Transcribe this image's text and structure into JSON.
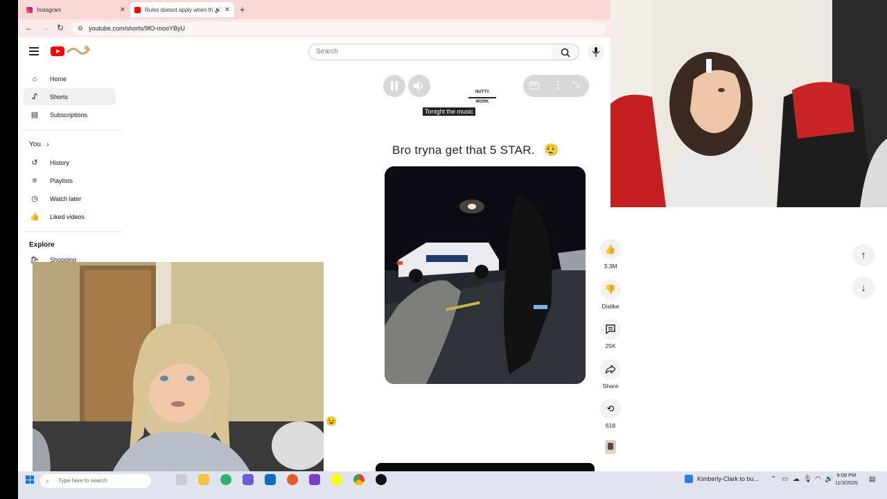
{
  "browser": {
    "tabs": [
      {
        "title": "Instagram",
        "favicon": "instagram-icon"
      },
      {
        "title": "Rules doesnt apply when th",
        "favicon": "youtube-icon",
        "active": true
      }
    ],
    "url": "youtube.com/shorts/9fO-mooYByU"
  },
  "header": {
    "search_placeholder": "Search"
  },
  "sidebar": {
    "items": [
      {
        "label": "Home",
        "icon": "home-icon"
      },
      {
        "label": "Shorts",
        "icon": "shorts-icon",
        "active": true
      },
      {
        "label": "Subscriptions",
        "icon": "subscriptions-icon"
      }
    ],
    "you_label": "You",
    "you_items": [
      {
        "label": "History",
        "icon": "history-icon"
      },
      {
        "label": "Playlists",
        "icon": "playlists-icon"
      },
      {
        "label": "Watch later",
        "icon": "clock-icon"
      },
      {
        "label": "Liked videos",
        "icon": "thumbs-up-icon"
      }
    ],
    "explore_label": "Explore",
    "explore_items": [
      {
        "label": "Shopping",
        "icon": "shopping-bag-icon"
      }
    ]
  },
  "player": {
    "caption": "Tonight the music",
    "overlay_text": "Bro tryna get that 5 STAR.",
    "overlay_emoji": "😮‍💨",
    "channel_watermark": "NUTTY WORK",
    "cc_label": "CC"
  },
  "actions": {
    "like_count": "3.3M",
    "dislike_label": "Dislike",
    "comment_count": "25K",
    "share_label": "Share",
    "remix_count": "618"
  },
  "taskbar": {
    "search_placeholder": "Type here to search",
    "news": "Kimberly-Clark to bu...",
    "time": "9:09 PM",
    "date": "11/3/2025"
  },
  "colors": {
    "tab_bar": "#f8d7d7",
    "youtube_red": "#ff0000",
    "taskbar": "#dfe4ee"
  }
}
